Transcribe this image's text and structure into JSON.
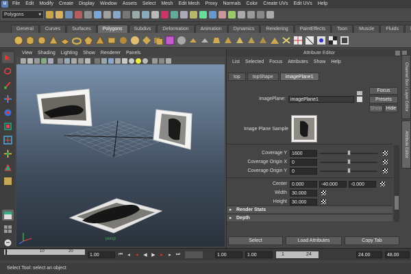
{
  "menubar": {
    "items": [
      "File",
      "Edit",
      "Modify",
      "Create",
      "Display",
      "Window",
      "Assets",
      "Select",
      "Mesh",
      "Edit Mesh",
      "Proxy",
      "Normals",
      "Color",
      "Create UVs",
      "Edit UVs",
      "Help"
    ]
  },
  "statusline": {
    "mode": "Polygons"
  },
  "shelf": {
    "tabs": [
      "General",
      "Curves",
      "Surfaces",
      "Polygons",
      "Subdivs",
      "Deformation",
      "Animation",
      "Dynamics",
      "Rendering",
      "PaintEffects",
      "Toon",
      "Muscle",
      "Fluids",
      "Fur"
    ],
    "active_tab": "Polygons"
  },
  "viewport": {
    "menu": [
      "View",
      "Shading",
      "Lighting",
      "Show",
      "Renderer",
      "Panels"
    ],
    "camera_label": "persp"
  },
  "attribute_editor": {
    "title": "Attribute Editor",
    "menu": [
      "List",
      "Selected",
      "Focus",
      "Attributes",
      "Show",
      "Help"
    ],
    "tabs": [
      "top",
      "topShape",
      "imagePlane1"
    ],
    "active_tab": "imagePlane1",
    "node_label": "imagePlane:",
    "node_name": "imagePlane1",
    "focus_button": "Focus",
    "presets_button": "Presets",
    "show_button": "Show",
    "hide_button": "Hide",
    "sample_label": "Image Plane Sample",
    "rows": [
      {
        "label": "Coverage Y",
        "value": "1600"
      },
      {
        "label": "Coverage Origin X",
        "value": "0"
      },
      {
        "label": "Coverage Origin Y",
        "value": "0"
      }
    ],
    "center_label": "Center",
    "center": [
      "0.000",
      "-40.000",
      "-0.000"
    ],
    "width_label": "Width",
    "width": "30.000",
    "height_label": "Height",
    "height": "30.000",
    "sections": [
      "Render Stats",
      "Depth"
    ],
    "bottom_buttons": [
      "Select",
      "Load Attributes",
      "Copy Tab"
    ]
  },
  "side_tabs": [
    "Channel Box / Layer Editor",
    "Attribute Editor"
  ],
  "timeslider": {
    "ticks": [
      "1",
      "10",
      "20"
    ],
    "current_time": "1.00",
    "range_start": "1.00",
    "range_start2": "1.00",
    "range_current": "1",
    "range_mid": "24",
    "range_end": "24.00",
    "range_end2": "48.00"
  },
  "helpline": {
    "text": "Select Tool: select an object"
  },
  "colors": {
    "accent_red": "#d03030",
    "maya_blue": "#5a7fb5"
  }
}
